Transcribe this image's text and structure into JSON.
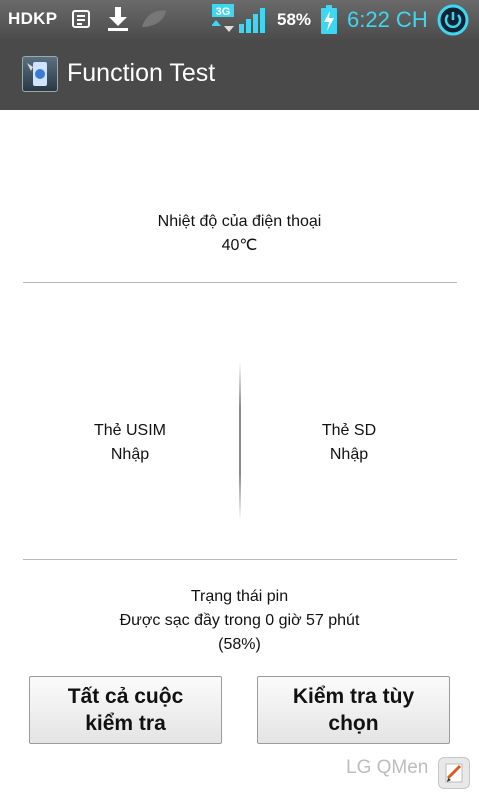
{
  "status_bar": {
    "carrier": "HDKP",
    "network_type": "3G",
    "battery_percent": "58%",
    "time": "6:22 CH",
    "accent_color": "#3fd7f0",
    "icons": [
      "notes-icon",
      "download-icon",
      "leaf-icon",
      "signal-icon",
      "battery-charging-icon",
      "power-icon"
    ]
  },
  "app": {
    "title": "Function Test"
  },
  "phone_temp": {
    "label": "Nhiệt độ của điện thoại",
    "value": "40℃"
  },
  "usim": {
    "label": "Thẻ USIM",
    "status": "Nhập"
  },
  "sd": {
    "label": "Thẻ SD",
    "status": "Nhập"
  },
  "battery": {
    "label": "Trạng thái pin",
    "detail": "Được sạc đầy trong 0 giờ 57 phút",
    "percent": "(58%)"
  },
  "buttons": {
    "all_tests": "Tất cả cuộc kiểm tra",
    "custom_test": "Kiểm tra tùy chọn"
  },
  "watermark": {
    "text": "LG QMen"
  }
}
